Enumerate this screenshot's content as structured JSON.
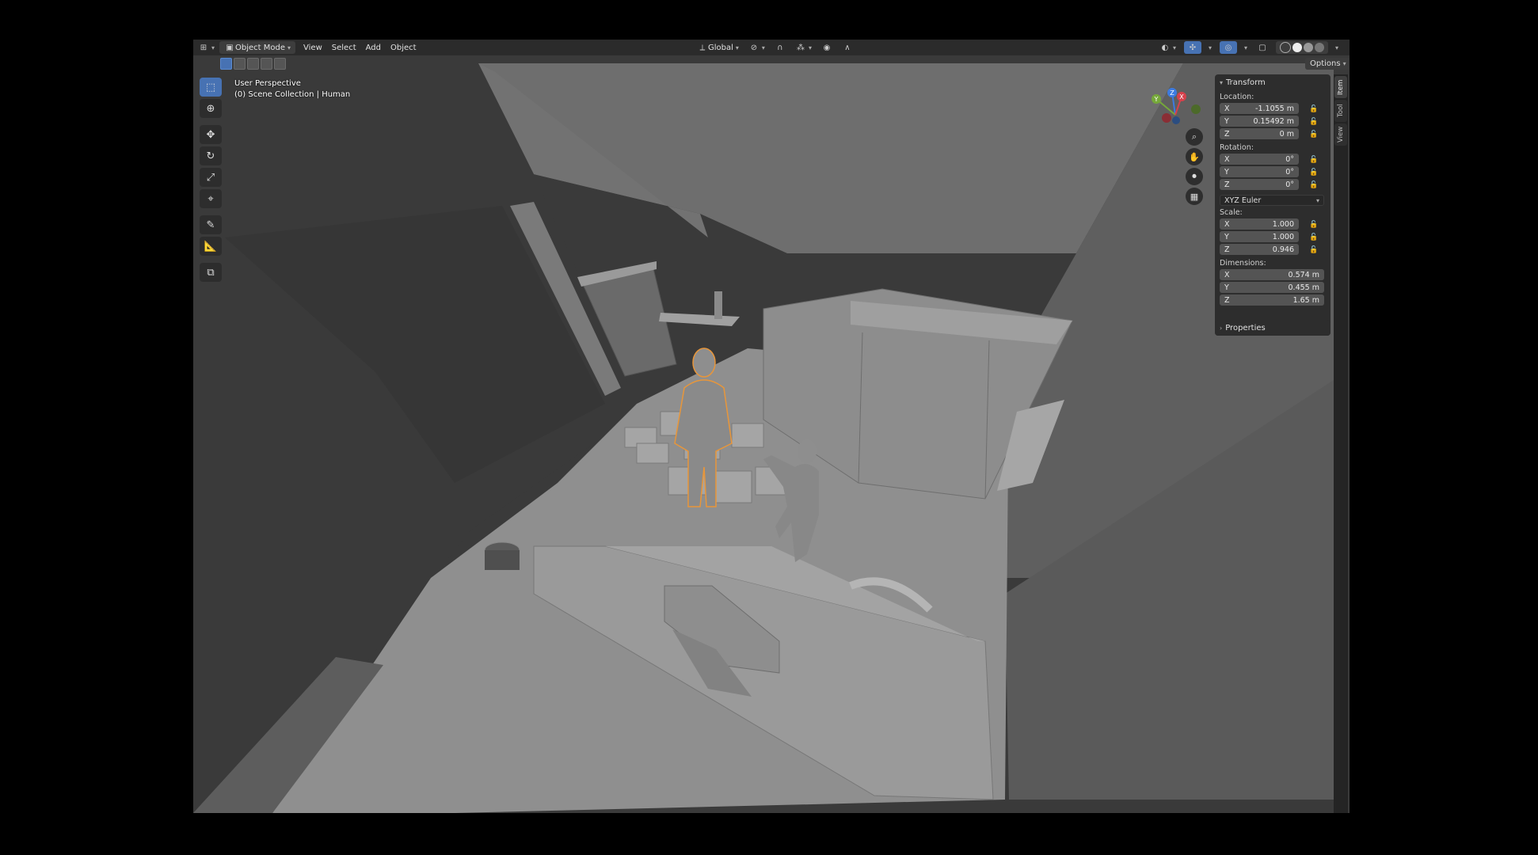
{
  "header": {
    "editor_type_icon": "cube-editor-icon",
    "mode_label": "Object Mode",
    "menus": [
      "View",
      "Select",
      "Add",
      "Object"
    ],
    "orientation_label": "Global",
    "options_label": "Options"
  },
  "viewport": {
    "perspective_label": "User Perspective",
    "collection_label": "(0) Scene Collection | Human"
  },
  "gizmo": {
    "x_label": "X",
    "y_label": "Y",
    "z_label": "Z",
    "colors": {
      "x": "#d7414c",
      "y": "#76a83a",
      "z": "#3d7be0"
    }
  },
  "toolbar": {
    "tools": [
      "select-box-icon",
      "cursor-icon",
      "move-icon",
      "rotate-icon",
      "scale-icon",
      "transform-icon",
      "annotate-icon",
      "measure-icon",
      "add-cube-icon"
    ]
  },
  "npanel": {
    "transform_title": "Transform",
    "location_label": "Location:",
    "location": [
      {
        "axis": "X",
        "value": "-1.1055 m"
      },
      {
        "axis": "Y",
        "value": "0.15492 m"
      },
      {
        "axis": "Z",
        "value": "0 m"
      }
    ],
    "rotation_label": "Rotation:",
    "rotation": [
      {
        "axis": "X",
        "value": "0°"
      },
      {
        "axis": "Y",
        "value": "0°"
      },
      {
        "axis": "Z",
        "value": "0°"
      }
    ],
    "rotation_mode": "XYZ Euler",
    "scale_label": "Scale:",
    "scale": [
      {
        "axis": "X",
        "value": "1.000"
      },
      {
        "axis": "Y",
        "value": "1.000"
      },
      {
        "axis": "Z",
        "value": "0.946"
      }
    ],
    "dimensions_label": "Dimensions:",
    "dimensions": [
      {
        "axis": "X",
        "value": "0.574 m"
      },
      {
        "axis": "Y",
        "value": "0.455 m"
      },
      {
        "axis": "Z",
        "value": "1.65 m"
      }
    ],
    "properties_title": "Properties"
  },
  "sidetabs": [
    "Item",
    "Tool",
    "View"
  ],
  "accent_color": "#4772b3",
  "selection_outline_color": "#e8963a"
}
